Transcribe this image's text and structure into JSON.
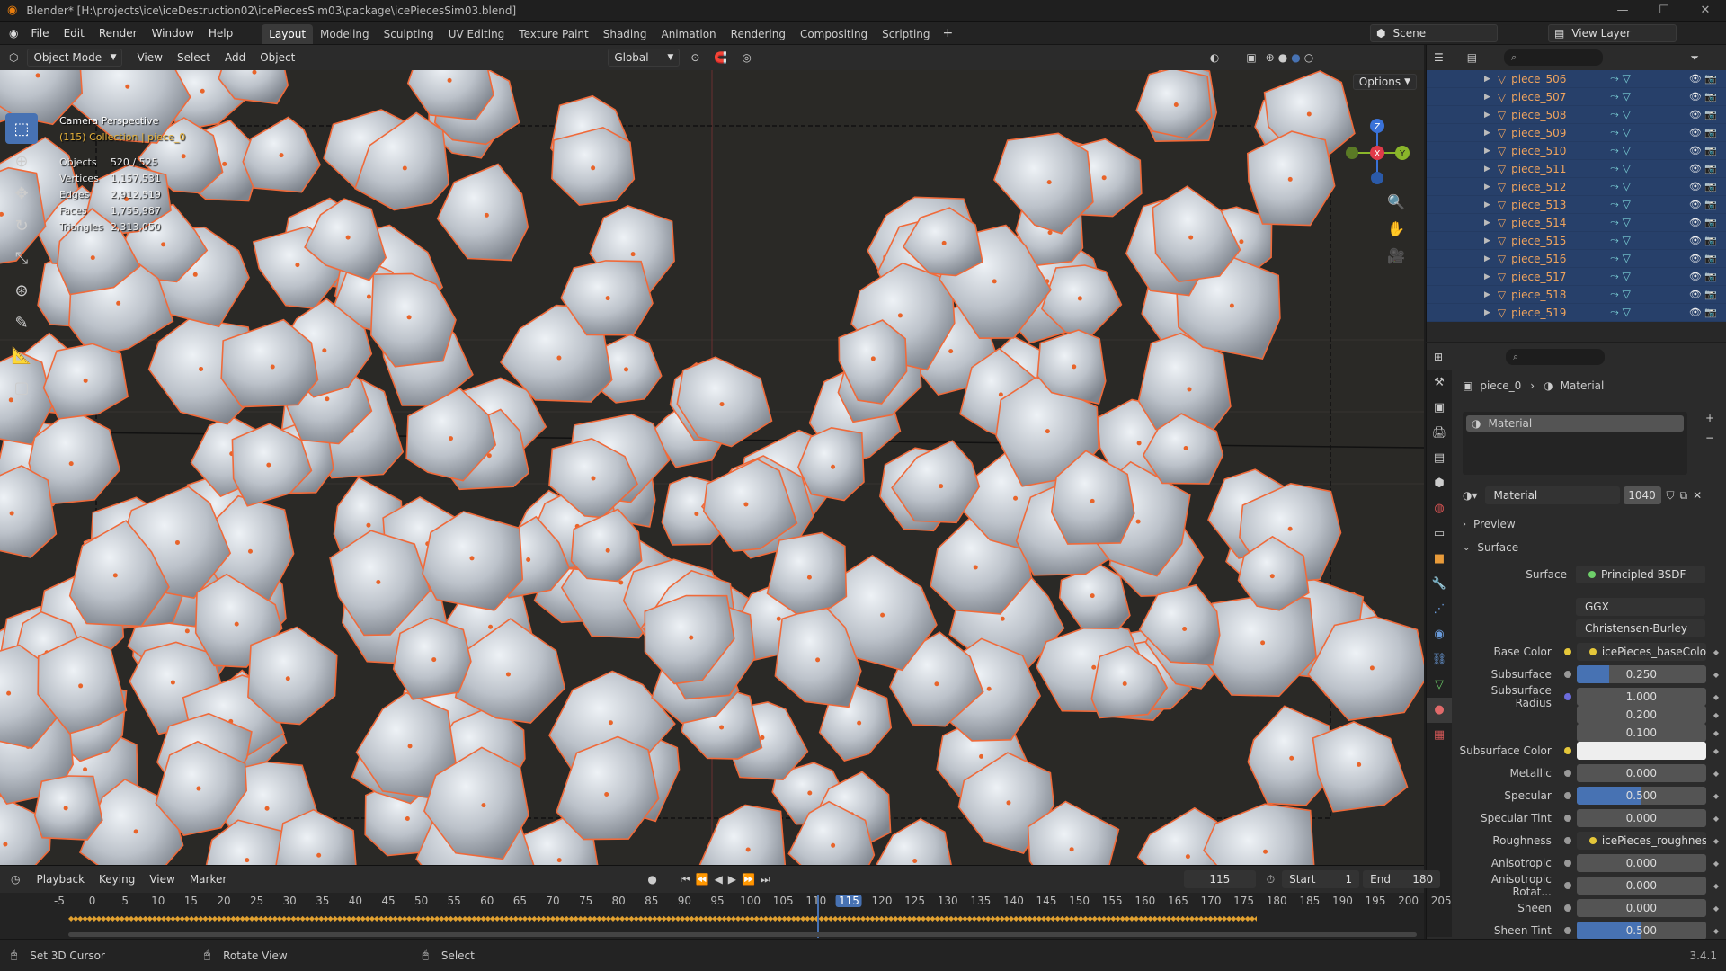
{
  "window": {
    "title": "Blender* [H:\\projects\\ice\\iceDestruction02\\icePiecesSim03\\package\\icePiecesSim03.blend]"
  },
  "menu": [
    "File",
    "Edit",
    "Render",
    "Window",
    "Help"
  ],
  "workspaces": [
    "Layout",
    "Modeling",
    "Sculpting",
    "UV Editing",
    "Texture Paint",
    "Shading",
    "Animation",
    "Rendering",
    "Compositing",
    "Scripting"
  ],
  "scene": {
    "name": "Scene",
    "view_layer": "View Layer"
  },
  "viewport_header": {
    "mode": "Object Mode",
    "menus": [
      "View",
      "Select",
      "Add",
      "Object"
    ],
    "orientation": "Global",
    "options": "Options"
  },
  "viewport": {
    "camera": "Camera Perspective",
    "collection": "(115) Collection | piece_0",
    "stats": [
      {
        "k": "Objects",
        "v": "520 / 525"
      },
      {
        "k": "Vertices",
        "v": "1,157,531"
      },
      {
        "k": "Edges",
        "v": "2,912,519"
      },
      {
        "k": "Faces",
        "v": "1,755,987"
      },
      {
        "k": "Triangles",
        "v": "2,313,050"
      }
    ]
  },
  "gizmo": {
    "z": "Z",
    "x": "X",
    "y": "Y"
  },
  "outliner": {
    "items": [
      "piece_506",
      "piece_507",
      "piece_508",
      "piece_509",
      "piece_510",
      "piece_511",
      "piece_512",
      "piece_513",
      "piece_514",
      "piece_515",
      "piece_516",
      "piece_517",
      "piece_518",
      "piece_519"
    ]
  },
  "properties": {
    "breadcrumb_object": "piece_0",
    "breadcrumb_tab": "Material",
    "slot": "Material",
    "material_name": "Material",
    "users": "1040",
    "preview": "Preview",
    "surface_panel": "Surface",
    "surface_label": "Surface",
    "surface_value": "Principled BSDF",
    "dist": "GGX",
    "sss_method": "Christensen-Burley",
    "rows": [
      {
        "label": "Base Color",
        "value": "icePieces_baseColor.jpg",
        "type": "tex",
        "dot": "#e5c73a"
      },
      {
        "label": "Subsurface",
        "value": "0.250",
        "type": "num",
        "fill": 0.25,
        "dot": "#999"
      },
      {
        "label": "Subsurface Radius",
        "value": "1.000",
        "type": "num",
        "fill": 0,
        "dot": "#6c6cdc"
      },
      {
        "label": "",
        "value": "0.200",
        "type": "num",
        "fill": 0,
        "dot": ""
      },
      {
        "label": "",
        "value": "0.100",
        "type": "num",
        "fill": 0,
        "dot": ""
      },
      {
        "label": "Subsurface Color",
        "value": "",
        "type": "color",
        "dot": "#e5c73a"
      },
      {
        "label": "Metallic",
        "value": "0.000",
        "type": "num",
        "fill": 0,
        "dot": "#999"
      },
      {
        "label": "Specular",
        "value": "0.500",
        "type": "num",
        "fill": 0.5,
        "dot": "#999"
      },
      {
        "label": "Specular Tint",
        "value": "0.000",
        "type": "num",
        "fill": 0,
        "dot": "#999"
      },
      {
        "label": "Roughness",
        "value": "icePieces_roughness.jpg",
        "type": "tex",
        "dot": "#999"
      },
      {
        "label": "Anisotropic",
        "value": "0.000",
        "type": "num",
        "fill": 0,
        "dot": "#999"
      },
      {
        "label": "Anisotropic Rotat...",
        "value": "0.000",
        "type": "num",
        "fill": 0,
        "dot": "#999"
      },
      {
        "label": "Sheen",
        "value": "0.000",
        "type": "num",
        "fill": 0,
        "dot": "#999"
      },
      {
        "label": "Sheen Tint",
        "value": "0.500",
        "type": "num",
        "fill": 0.5,
        "dot": "#999"
      }
    ]
  },
  "timeline": {
    "menus": [
      "Playback",
      "Keying",
      "View",
      "Marker"
    ],
    "current": "115",
    "start_label": "Start",
    "start": "1",
    "end_label": "End",
    "end": "180",
    "ticks": [
      "-5",
      "0",
      "5",
      "10",
      "15",
      "20",
      "25",
      "30",
      "35",
      "40",
      "45",
      "50",
      "55",
      "60",
      "65",
      "70",
      "75",
      "80",
      "85",
      "90",
      "95",
      "100",
      "105",
      "110",
      "115",
      "120",
      "125",
      "130",
      "135",
      "140",
      "145",
      "150",
      "155",
      "160",
      "165",
      "170",
      "175",
      "180",
      "185",
      "190",
      "195",
      "200",
      "205"
    ]
  },
  "status": {
    "left": "Set 3D Cursor",
    "mid": "Rotate View",
    "right": "Select",
    "version": "3.4.1"
  }
}
